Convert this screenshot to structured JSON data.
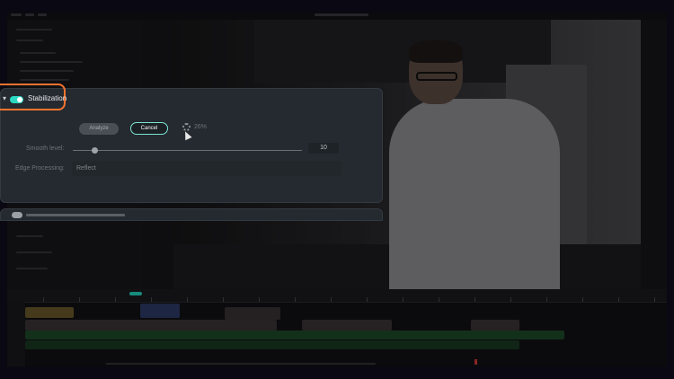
{
  "stabilization": {
    "title": "Stabilization",
    "enabled": true,
    "analyze_label": "Analyze",
    "cancel_label": "Cancel",
    "progress_text": "26%",
    "smooth_level_label": "Smooth level:",
    "smooth_level_value": "10",
    "edge_processing_label": "Edge Processing:",
    "edge_processing_value": "Reflect"
  },
  "colors": {
    "accent": "#2cd8c2",
    "highlight_ring": "#f7742f",
    "panel_bg": "#252a30"
  },
  "icons": [
    "chevron-down-icon",
    "loading-spinner-icon",
    "mouse-cursor-icon"
  ]
}
